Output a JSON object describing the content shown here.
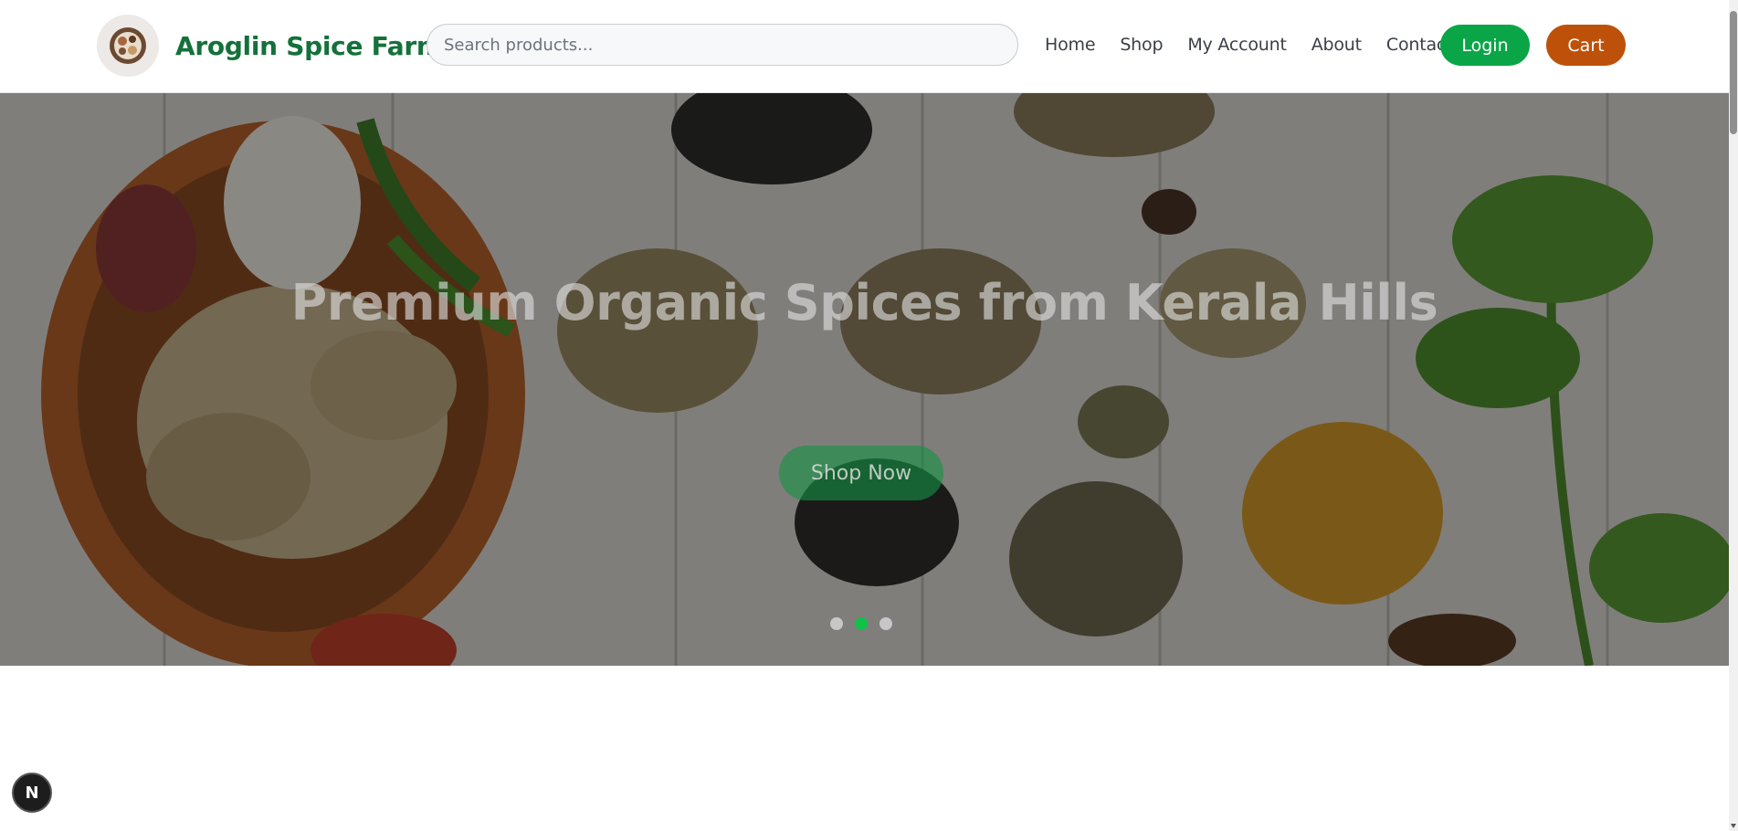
{
  "header": {
    "brand_name": "Aroglin Spice Farms",
    "logo_icon": "spice-bowl-logo-icon",
    "search": {
      "placeholder": "Search products...",
      "value": ""
    },
    "nav": [
      "Home",
      "Shop",
      "My Account",
      "About",
      "Contact"
    ],
    "login_label": "Login",
    "cart_label": "Cart"
  },
  "hero": {
    "title": "Premium Organic Spices from Kerala Hills",
    "cta_label": "Shop Now",
    "slides_total": 3,
    "active_slide": 2
  },
  "floating_badge": {
    "label": "N"
  },
  "colors": {
    "brand_green": "#14713a",
    "login_green": "#0aa547",
    "cart_orange": "#bd5109",
    "dot_active": "#10c24a"
  }
}
